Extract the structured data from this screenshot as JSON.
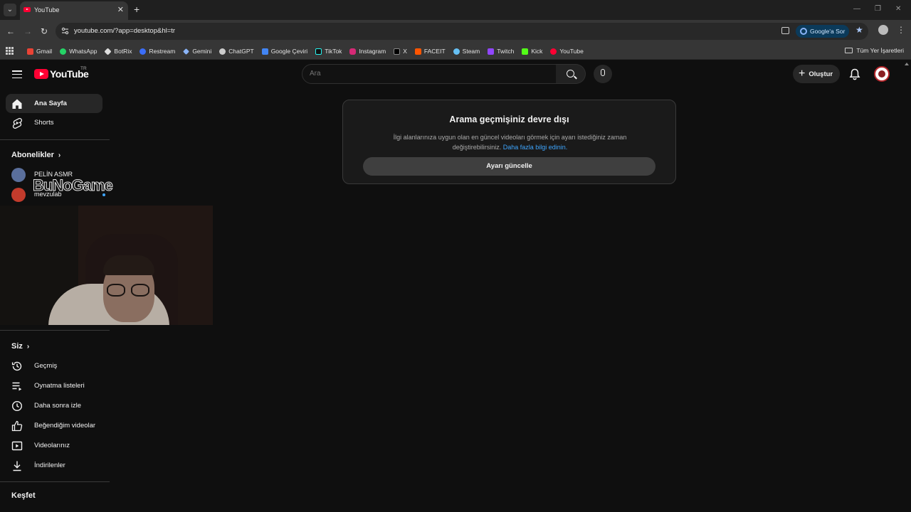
{
  "browser": {
    "tab_title": "YouTube",
    "url": "youtube.com/?app=desktop&hl=tr",
    "ask_google": "Google'a Sor",
    "bookmarks": [
      "Gmail",
      "WhatsApp",
      "BotRix",
      "Restream",
      "Gemini",
      "ChatGPT",
      "Google Çeviri",
      "TikTok",
      "Instagram",
      "X",
      "FACEIT",
      "Steam",
      "Twitch",
      "Kick",
      "YouTube"
    ],
    "all_bookmarks": "Tüm Yer İşaretleri"
  },
  "youtube": {
    "logo_text": "YouTube",
    "country_code": "TR",
    "search_placeholder": "Ara",
    "create_label": "Oluştur"
  },
  "sidebar": {
    "home": "Ana Sayfa",
    "shorts": "Shorts",
    "subscriptions_header": "Abonelikler",
    "subscriptions": [
      {
        "name": "PELİN ASMR"
      },
      {
        "name": "mevzulab"
      }
    ],
    "you_header": "Siz",
    "you_items": [
      "Geçmiş",
      "Oynatma listeleri",
      "Daha sonra izle",
      "Beğendiğim videolar",
      "Videolarınız",
      "İndirilenler"
    ],
    "explore_header": "Keşfet",
    "overlay_text": "BuNoGame"
  },
  "notice": {
    "title": "Arama geçmişiniz devre dışı",
    "body": "İlgi alanlarınıza uygun olan en güncel videoları görmek için ayarı istediğiniz zaman değiştirebilirsiniz.",
    "link": "Daha fazla bilgi edinin.",
    "button": "Ayarı güncelle"
  }
}
